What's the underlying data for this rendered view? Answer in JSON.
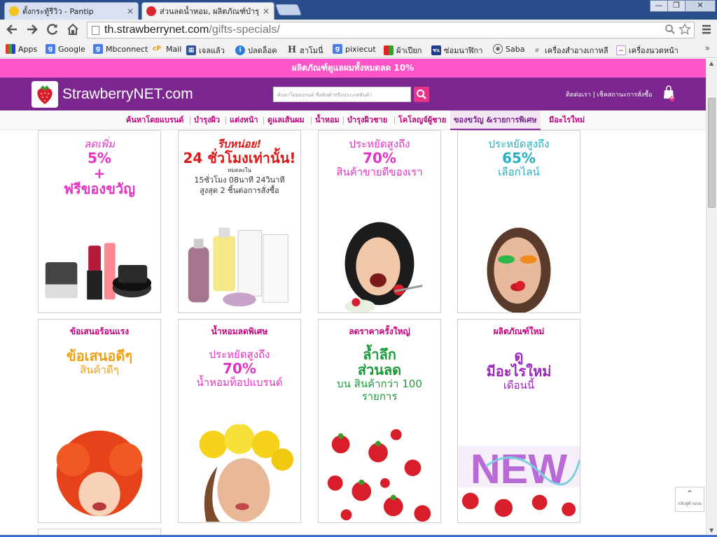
{
  "browser": {
    "tabs": [
      {
        "title": "ตั้งกระทู้รีวิว - Pantip",
        "close": "×",
        "active": false
      },
      {
        "title": "ส่วนลดน้ำหอม, ผลิตภัณฑ์บำรุ",
        "close": "×",
        "active": true
      }
    ],
    "window_controls": {
      "minimize": "—",
      "maximize": "❐",
      "close": "✕"
    },
    "url_host": "th.strawberrynet.com",
    "url_path": "/gifts-specials/",
    "bookmarks": [
      "Apps",
      "Google",
      "Mbconnect",
      "Mail",
      "เจลแล้ว",
      "ปลดล็อค",
      "ฮาโมนี่",
      "pixiecut",
      "ผ้าเปียก",
      "ซ่อมนาฬิกา",
      "Saba",
      "เครื่องสำอางเกาหลี",
      "เครื่องนวดหน้า"
    ],
    "bookmarks_more": "»"
  },
  "site": {
    "promo_bar": "ผลิตภัณฑ์ดูแลผมทั้งหมดลด 10%",
    "logo_text": "StrawberryNET.com",
    "search_placeholder": "ค้นหาโดยแบรนด์ ชื่อสินค้าหรือประเภทสินค้า",
    "header_links": "ติดต่อเรา  |  เช็คสถานะการสั่งซื้อ",
    "cart_count": "0",
    "nav": [
      "ค้นหาโดยแบรนด์",
      "บำรุงผิว",
      "แต่งหน้า",
      "ดูแลเส้นผม",
      "น้ำหอม",
      "บำรุงผิวชาย",
      "โคโลญจ์ผู้ชาย",
      "ของขวัญ &รายการพิเศษ",
      "มีอะไรใหม่"
    ],
    "back_to_top": "กลับสู่ด้านบน"
  },
  "cards": [
    {
      "line1": "ลดเพิ่ม",
      "line2": "5%",
      "line3": "+",
      "line4": "ฟรีของขวัญ"
    },
    {
      "line1": "รีบหน่อย!",
      "line2": "24 ชั่วโมงเท่านั้น!",
      "line3": "หมดลงใน",
      "line4": "15ชั่วโมง 08นาที 24วินาที",
      "line5": "สูงสุด 2 ชิ้นต่อการสั่งซื้อ"
    },
    {
      "line1": "ประหยัดสูงถึง",
      "line2": "70%",
      "line3": "สินค้าขายดีของเรา"
    },
    {
      "line1": "ประหยัดสูงถึง",
      "line2": "65%",
      "line3": "เลือกไลน์"
    },
    {
      "title": "ข้อเสนอร้อนแรง",
      "line1": "ข้อเสนอดีๆ",
      "line2": "สินค้าดีๆ"
    },
    {
      "title": "น้ำหอมลดพิเศษ",
      "line1": "ประหยัดสูงถึง",
      "line2": "70%",
      "line3": "น้ำหอมท็อปแบรนด์"
    },
    {
      "title": "ลดราคาครั้งใหญ่",
      "line1": "ล้ำลึก",
      "line2": "ส่วนลด",
      "line3": "บน สินค้ากว่า 100",
      "line4": "รายการ"
    },
    {
      "title": "ผลิตภัณฑ์ใหม่",
      "line1": "ดู",
      "line2": "มีอะไรใหม่",
      "line3": "เดือนนี้",
      "img_word": "NEW"
    }
  ],
  "colors": {
    "promo_pink": "#ff55c9",
    "header_purple": "#7c2690",
    "nav_magenta": "#c0007a",
    "text_pink": "#e233c3",
    "text_red": "#e01616",
    "text_teal": "#26b0bf",
    "text_orange": "#f0a010",
    "text_green": "#1a9b3a",
    "text_purple": "#9a27b8"
  }
}
